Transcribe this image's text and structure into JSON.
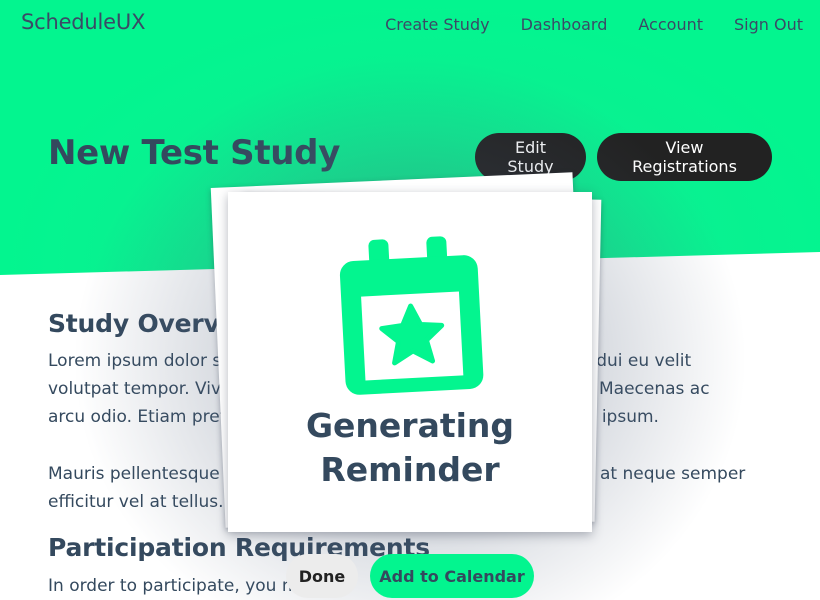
{
  "header": {
    "brand": "ScheduleUX",
    "nav": [
      {
        "label": "Create Study"
      },
      {
        "label": "Dashboard"
      },
      {
        "label": "Account"
      },
      {
        "label": "Sign Out"
      }
    ]
  },
  "study": {
    "title": "New Test Study",
    "actions": {
      "edit_label": "Edit Study",
      "view_registrations_label": "View Registrations"
    },
    "overview": {
      "heading": "Study Overview",
      "paragraph1_left": "Lorem ipsum dolor s",
      "paragraph1_right": "ngue dui eu velit",
      "paragraph1_line2_left": "volutpat tempor. Viv",
      "paragraph1_line2_right": "risus. Maecenas ac",
      "paragraph1_line3_left": "arcu odio. Etiam pret",
      "paragraph1_line3_right": "giat a ipsum.",
      "paragraph2_left": "Mauris pellentesque",
      "paragraph2_right": "at neque semper",
      "paragraph2_line2_left": "efficitur vel at tellus."
    },
    "requirements": {
      "heading": "Participation Requirements",
      "paragraph": "In order to participate, you must:"
    }
  },
  "modal": {
    "icon": "calendar-star-icon",
    "title_line1": "Generating",
    "title_line2": "Reminder",
    "done_label": "Done",
    "add_to_calendar_label": "Add to Calendar"
  },
  "colors": {
    "accent": "#03f58f",
    "text": "#34495e",
    "dark_button": "#222222"
  }
}
